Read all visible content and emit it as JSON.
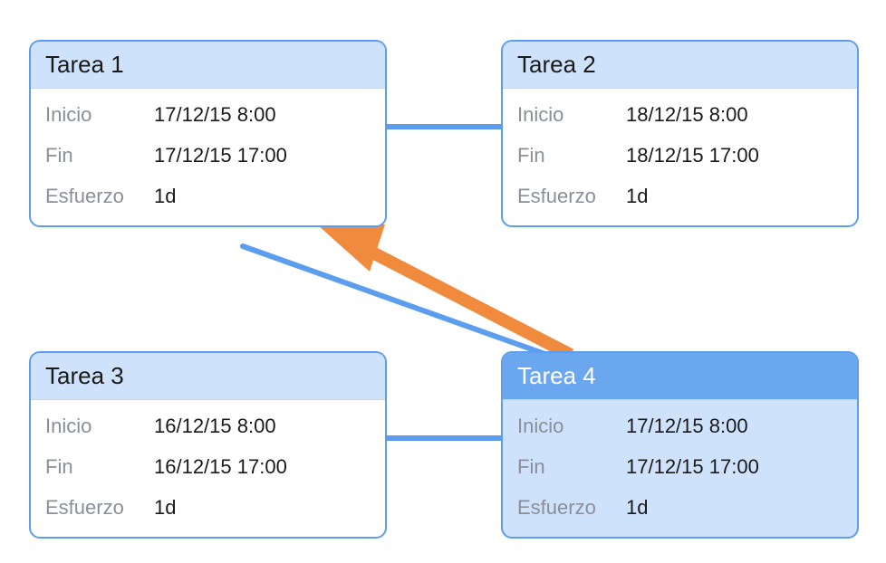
{
  "labels": {
    "start": "Inicio",
    "end": "Fin",
    "effort": "Esfuerzo"
  },
  "tasks": [
    {
      "title": "Tarea 1",
      "start": "17/12/15 8:00",
      "end": "17/12/15 17:00",
      "effort": "1d"
    },
    {
      "title": "Tarea 2",
      "start": "18/12/15 8:00",
      "end": "18/12/15 17:00",
      "effort": "1d"
    },
    {
      "title": "Tarea 3",
      "start": "16/12/15 8:00",
      "end": "16/12/15 17:00",
      "effort": "1d"
    },
    {
      "title": "Tarea 4",
      "start": "17/12/15 8:00",
      "end": "17/12/15 17:00",
      "effort": "1d"
    }
  ],
  "diagram": {
    "selected_task_index": 3,
    "connectors": [
      {
        "from": 0,
        "to": 1
      },
      {
        "from": 2,
        "to": 3
      }
    ],
    "drag_indicator": {
      "from_task_index": 3,
      "direction": "upper-left"
    }
  },
  "colors": {
    "border": "#5c9ded",
    "header_bg": "#cfe2fb",
    "selected_header_bg": "#6aa7ef",
    "arrow": "#f08a3c"
  }
}
